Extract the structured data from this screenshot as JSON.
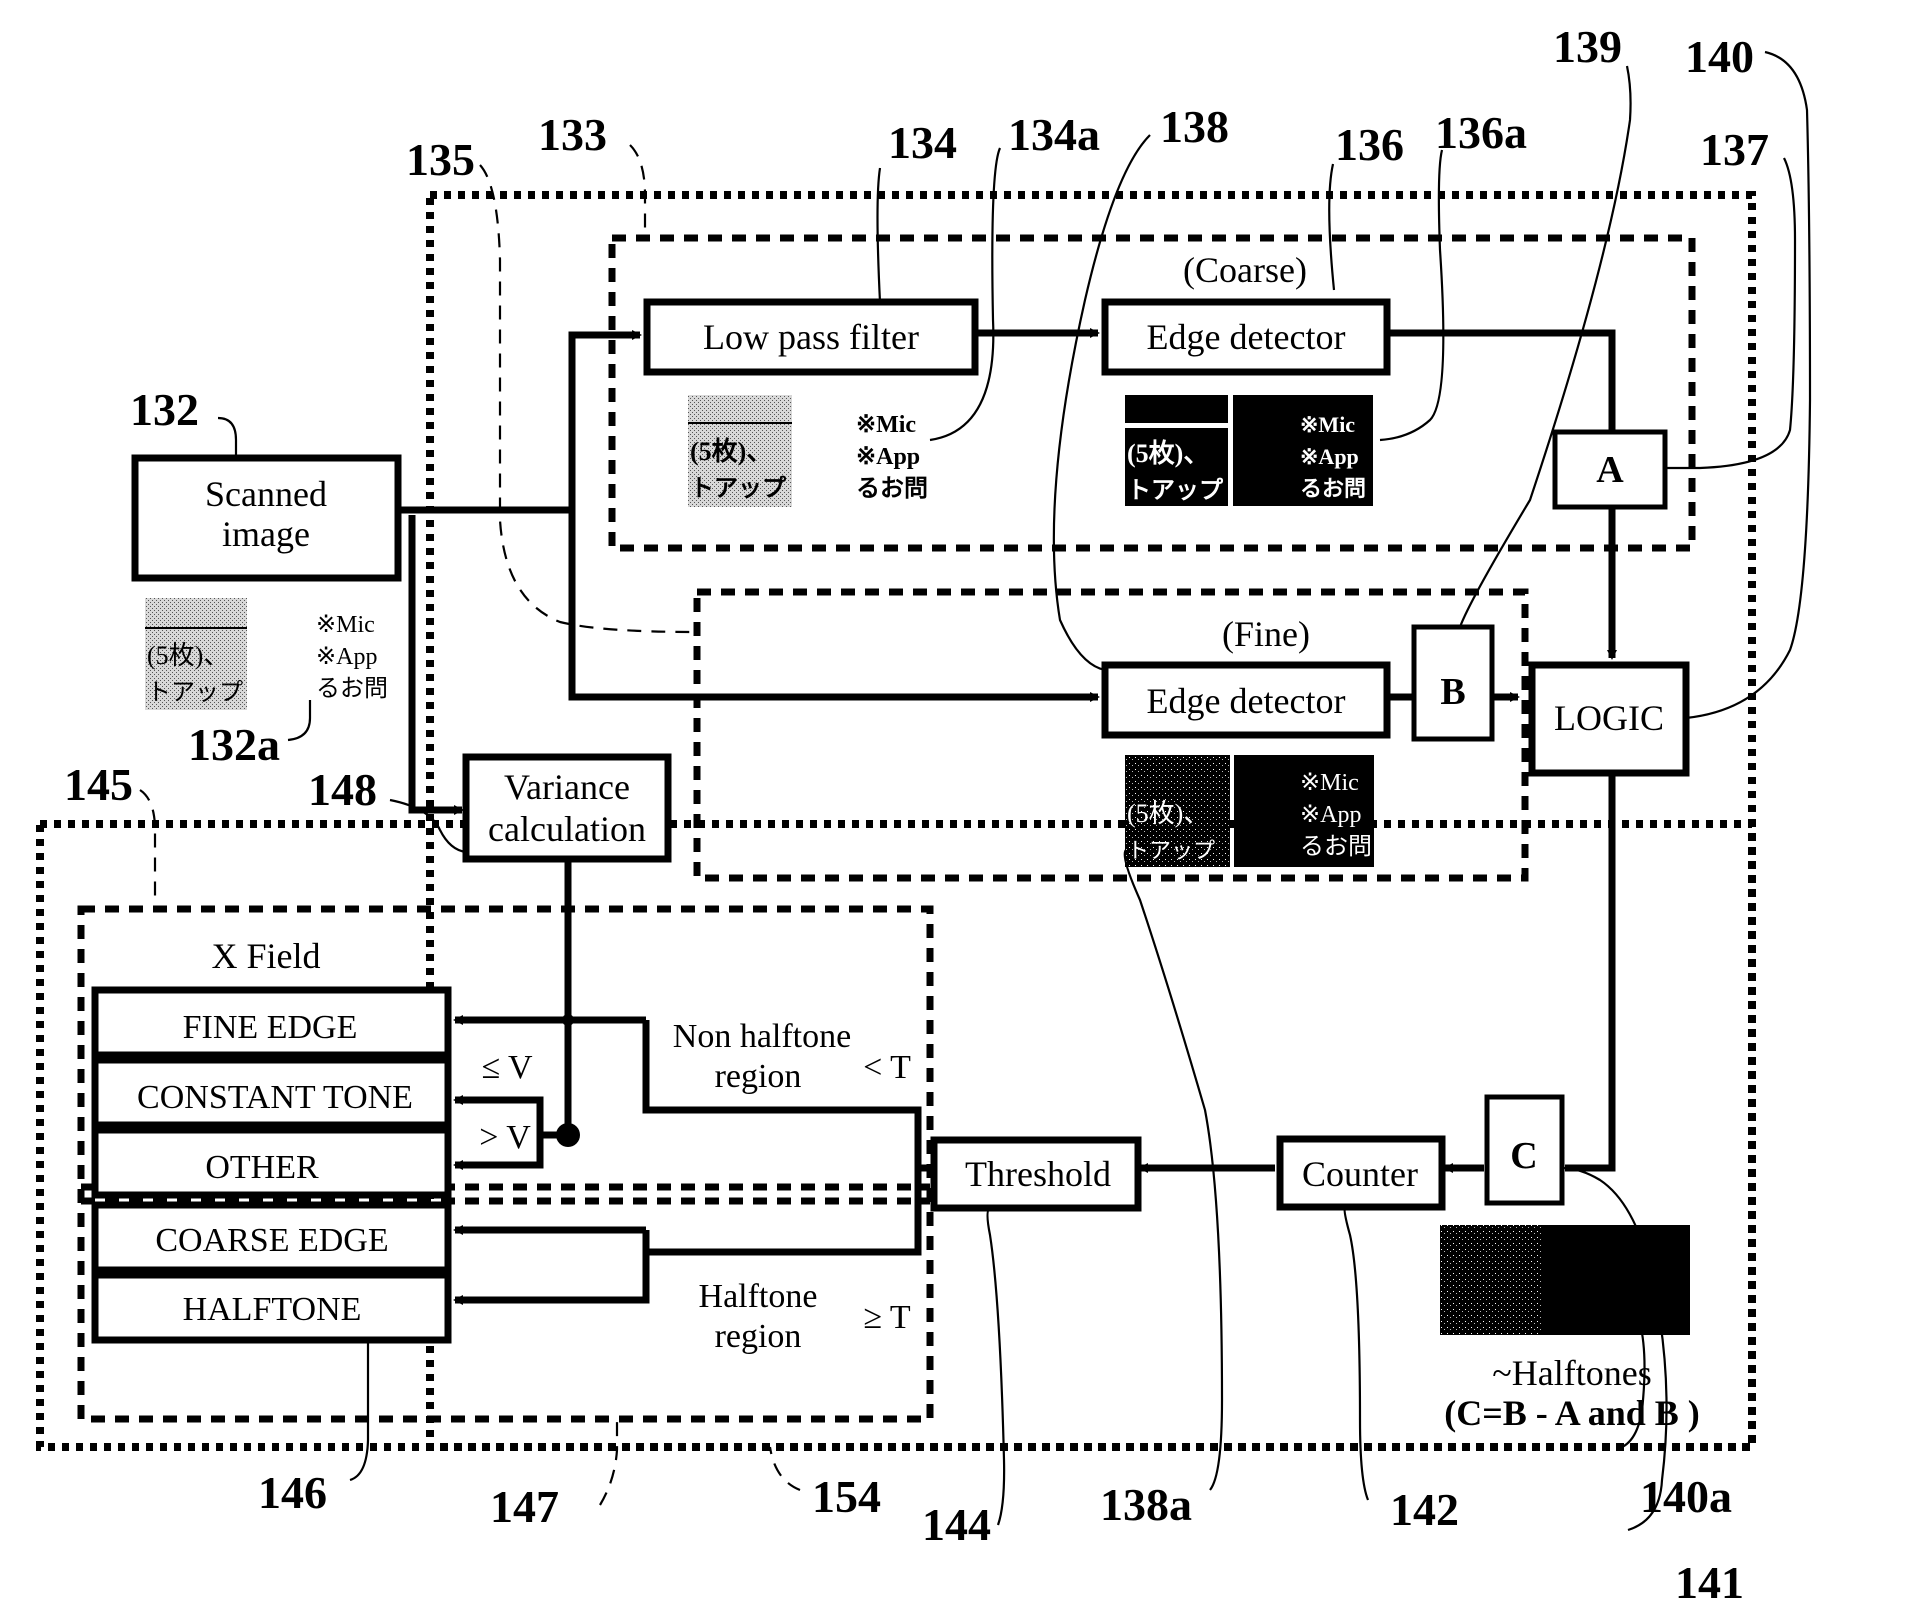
{
  "blocks": {
    "scanned_image": [
      "Scanned",
      "image"
    ],
    "low_pass_filter": "Low pass filter",
    "coarse_label": "(Coarse)",
    "edge_detector_coarse": "Edge detector",
    "fine_label": "(Fine)",
    "edge_detector_fine": "Edge detector",
    "a": "A",
    "b": "B",
    "c": "C",
    "logic": "LOGIC",
    "variance": [
      "Variance",
      "calculation"
    ],
    "threshold": "Threshold",
    "counter": "Counter"
  },
  "x_field": {
    "title": "X Field",
    "rows": [
      "FINE EDGE",
      "CONSTANT TONE",
      "OTHER",
      "COARSE EDGE",
      "HALFTONE"
    ]
  },
  "conditions": {
    "le_v": "≤ V",
    "gt_v": "> V",
    "non_halftone": [
      "Non halftone",
      "region"
    ],
    "lt_t": "< T",
    "halftone": [
      "Halftone",
      "region"
    ],
    "ge_t": "≥ T"
  },
  "halftones_caption": [
    "~Halftones",
    "(C=B - A and B )"
  ],
  "sample_text": {
    "left_block": [
      "(5枚)、",
      "トアップ"
    ],
    "right_block": [
      "※Mic",
      "※App",
      "るお問"
    ]
  },
  "reference_numerals": {
    "r132": "132",
    "r132a": "132a",
    "r133": "133",
    "r134": "134",
    "r134a": "134a",
    "r135": "135",
    "r136": "136",
    "r136a": "136a",
    "r137": "137",
    "r138": "138",
    "r138a": "138a",
    "r139": "139",
    "r140": "140",
    "r140a": "140a",
    "r141": "141",
    "r142": "142",
    "r144": "144",
    "r145": "145",
    "r146": "146",
    "r147": "147",
    "r148": "148",
    "r154": "154"
  }
}
